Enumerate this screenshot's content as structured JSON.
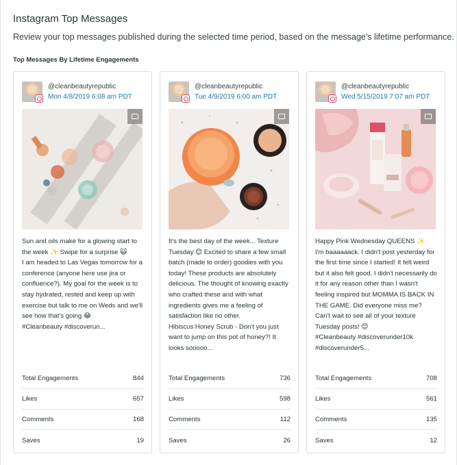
{
  "header": {
    "title": "Instagram Top Messages",
    "subtitle": "Review your top messages published during the selected time period, based on the message's lifetime performance.",
    "section_title": "Top Messages By Lifetime Engagements"
  },
  "cards": [
    {
      "handle": "@cleanbeautyrepublic",
      "date": "Mon 4/8/2019 6:08 am PDT",
      "media_icon": "carousel-icon",
      "caption": "Sun and oils make for a glowing start to the week ✨ Swipe for a surprise 😺\n      I am headed to Las Vegas tomorrow for a conference (anyone here use jira or confluence?). My goal for the week is to stay hydrated, rested and keep up with exercise but talk to me on Weds and we'll see how that's going 😂\n      #Cleanbeauty #discoverun...",
      "metrics": [
        {
          "label": "Total Engagements",
          "value": "844"
        },
        {
          "label": "Likes",
          "value": "657"
        },
        {
          "label": "Comments",
          "value": "168"
        },
        {
          "label": "Saves",
          "value": "19"
        }
      ]
    },
    {
      "handle": "@cleanbeautyrepublic",
      "date": "Tue 4/9/2019 6:00 am PDT",
      "media_icon": "carousel-icon",
      "caption": "It's the best day of the week... Texture Tuesday 😊                  Excited to share a few small batch (made to order) goodies with you today! These products are absolutely delicious. The thought of knowing exactly who crafted these and with what ingredients gives me a feeling of satisfaction like no other.\n                 Hibiscus Honey Scrub - Don't you just want to jump on this pot of honey?! It looks sooooo...",
      "metrics": [
        {
          "label": "Total Engagements",
          "value": "736"
        },
        {
          "label": "Likes",
          "value": "598"
        },
        {
          "label": "Comments",
          "value": "112"
        },
        {
          "label": "Saves",
          "value": "26"
        }
      ]
    },
    {
      "handle": "@cleanbeautyrepublic",
      "date": "Wed 5/15/2019 7:07 am PDT",
      "media_icon": "image-icon",
      "caption": "Happy Pink Wednesday QUEENS ✨\n                 I'm baaaaaack. I didn't post yesterday for the first time since I started! It felt weird but it also felt good. I didn't necessarily do it for any reason other than I wasn't feeling inspired but MOMMA IS BACK IN THE GAME. Did everyone miss me? Can't wait to see all of your texture Tuesday posts! 😊\n      #Cleanbeauty #discoverunder10k #discoverunder5...",
      "metrics": [
        {
          "label": "Total Engagements",
          "value": "708"
        },
        {
          "label": "Likes",
          "value": "561"
        },
        {
          "label": "Comments",
          "value": "135"
        },
        {
          "label": "Saves",
          "value": "12"
        }
      ]
    }
  ]
}
